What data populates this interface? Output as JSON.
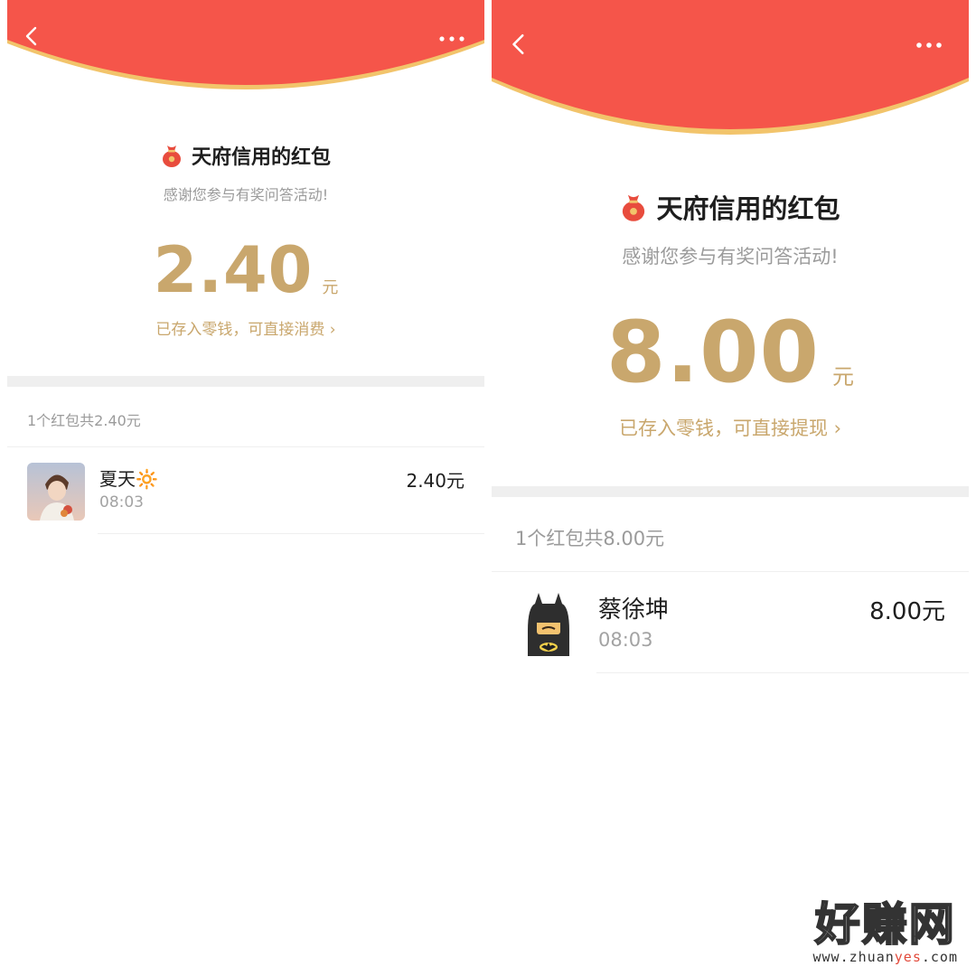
{
  "theme": {
    "header_red": "#f5554a",
    "gold": "#c9a76d",
    "arc_gold": "#f2c46b"
  },
  "screens": [
    {
      "back_icon": "chevron-left-icon",
      "more_icon": "more-dots-icon",
      "title_icon": "money-bag-icon",
      "title": "天府信用的红包",
      "subtitle": "感谢您参与有奖问答活动!",
      "amount": "2.40",
      "unit": "元",
      "stored_text": "已存入零钱，可直接消费",
      "summary": "1个红包共2.40元",
      "record": {
        "name": "夏天",
        "emoji": "🔆",
        "time": "08:03",
        "amount": "2.40元"
      }
    },
    {
      "back_icon": "chevron-left-icon",
      "more_icon": "more-dots-icon",
      "title_icon": "money-bag-icon",
      "title": "天府信用的红包",
      "subtitle": "感谢您参与有奖问答活动!",
      "amount": "8.00",
      "unit": "元",
      "stored_text": "已存入零钱，可直接提现",
      "summary": "1个红包共8.00元",
      "record": {
        "name": "蔡徐坤",
        "emoji": "",
        "time": "08:03",
        "amount": "8.00元"
      }
    }
  ],
  "watermark": {
    "logo": "好赚网",
    "url_prefix": "www.zhuan",
    "url_highlight": "yes",
    "url_suffix": ".com"
  }
}
